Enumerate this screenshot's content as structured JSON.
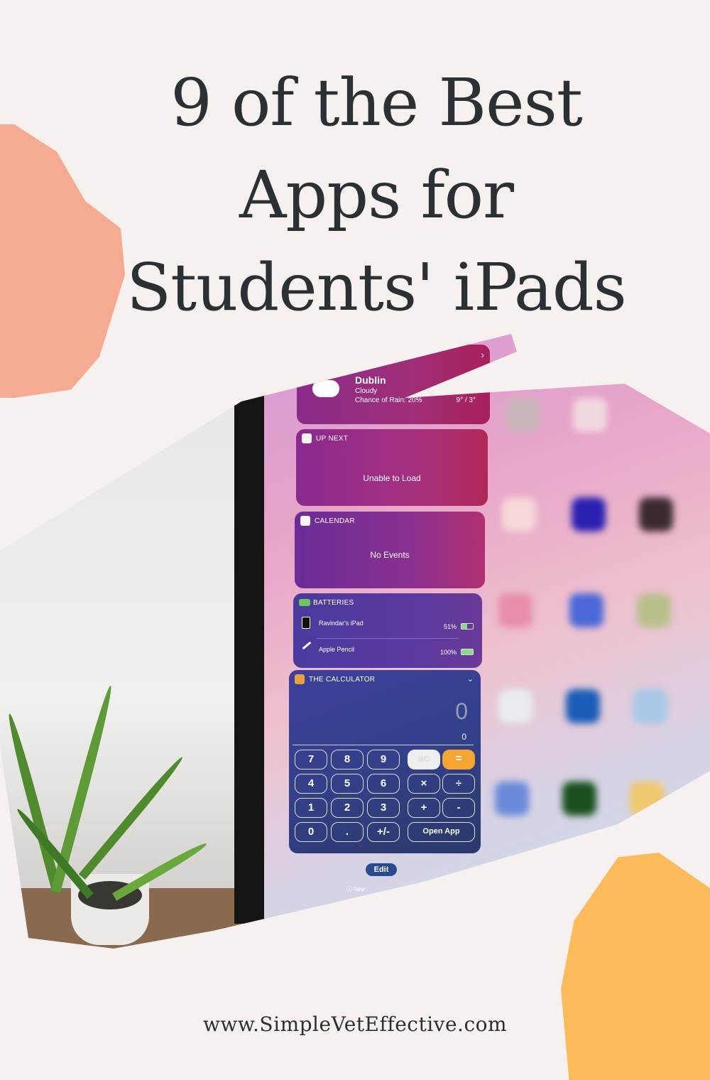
{
  "title": {
    "line1": "9 of the Best",
    "line2": "Apps for",
    "line3": "Students' iPads"
  },
  "footer": {
    "url": "www.SimpleVetEffective.com"
  },
  "colors": {
    "background": "#f6f0ee",
    "title": "#2b3035",
    "salmon_blob": "#f4ab91",
    "orange_blob": "#fbbb5b"
  },
  "widgets": {
    "weather": {
      "city": "Dublin",
      "condition": "Cloudy",
      "rain": "Chance of Rain: 20%",
      "temps": "9° / 3°",
      "chevron": "›"
    },
    "up_next": {
      "header": "UP NEXT",
      "message": "Unable to Load"
    },
    "calendar": {
      "header": "CALENDAR",
      "message": "No Events"
    },
    "batteries": {
      "header": "BATTERIES",
      "items": [
        {
          "name": "Ravindar's iPad",
          "level": "51%"
        },
        {
          "name": "Apple Pencil",
          "level": "100%"
        }
      ]
    },
    "calculator": {
      "header": "THE CALCULATOR",
      "display_big": "0",
      "display_small": "0",
      "keys": [
        "7",
        "8",
        "9",
        "4",
        "5",
        "6",
        "1",
        "2",
        "3",
        "0",
        ".",
        "+/-"
      ],
      "ops": [
        "ac",
        "=",
        "×",
        "÷",
        "+",
        "-"
      ],
      "open_app": "Open App"
    },
    "edit": "Edit",
    "new_label": "New"
  }
}
